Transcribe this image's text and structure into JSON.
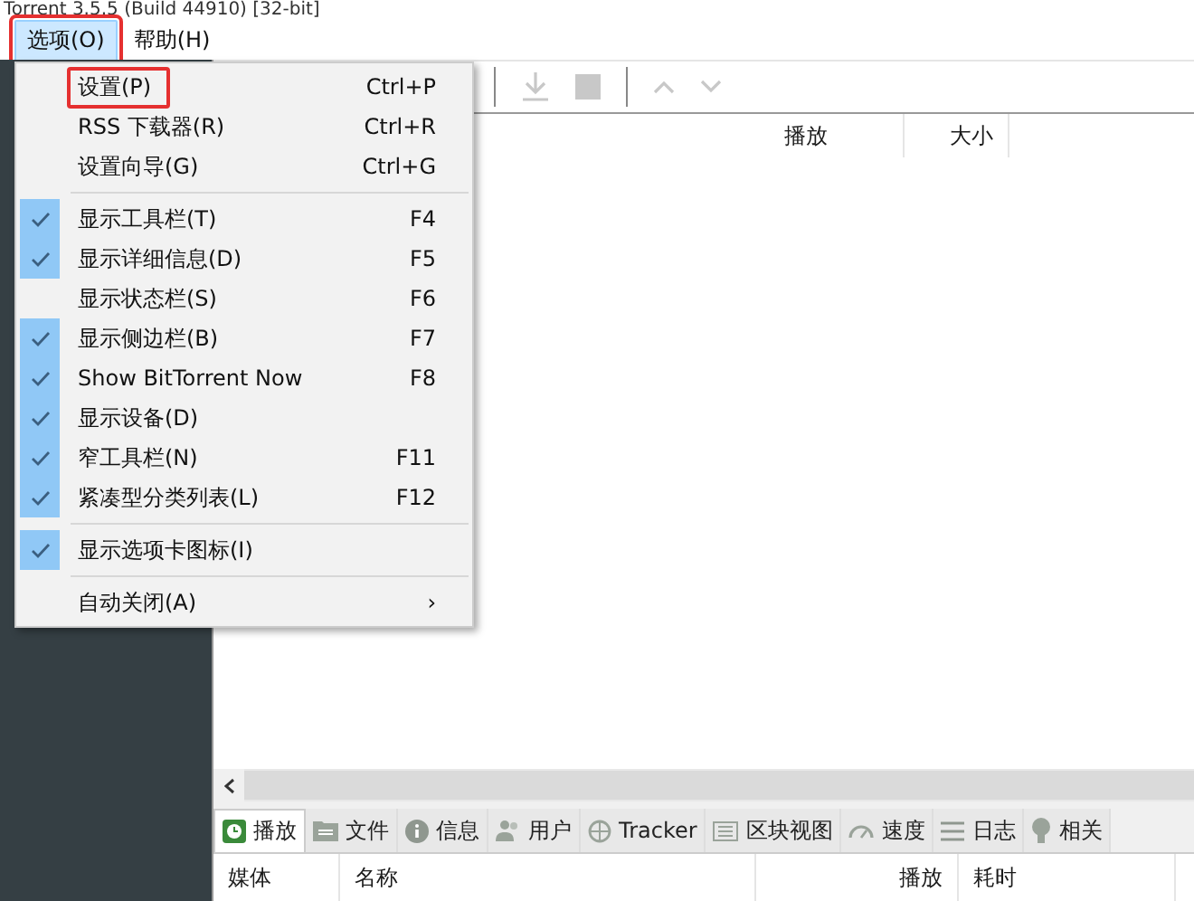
{
  "window": {
    "title": "Torrent 3.5.5  (Build 44910) [32-bit]"
  },
  "menubar": [
    {
      "label": "选项(O)",
      "selected": true,
      "highlighted": true
    },
    {
      "label": "帮助(H)",
      "selected": false,
      "highlighted": false
    }
  ],
  "menu": {
    "items": [
      {
        "kind": "item",
        "label": "设置(P)",
        "shortcut": "Ctrl+P",
        "checked": false,
        "highlighted": true
      },
      {
        "kind": "item",
        "label": "RSS 下载器(R)",
        "shortcut": "Ctrl+R",
        "checked": false,
        "highlighted": false
      },
      {
        "kind": "item",
        "label": "设置向导(G)",
        "shortcut": "Ctrl+G",
        "checked": false,
        "highlighted": false
      },
      {
        "kind": "separator"
      },
      {
        "kind": "item",
        "label": "显示工具栏(T)",
        "shortcut": "F4",
        "checked": true,
        "highlighted": false
      },
      {
        "kind": "item",
        "label": "显示详细信息(D)",
        "shortcut": "F5",
        "checked": true,
        "highlighted": false
      },
      {
        "kind": "item",
        "label": "显示状态栏(S)",
        "shortcut": "F6",
        "checked": false,
        "highlighted": false
      },
      {
        "kind": "item",
        "label": "显示侧边栏(B)",
        "shortcut": "F7",
        "checked": true,
        "highlighted": false
      },
      {
        "kind": "item",
        "label": "Show BitTorrent Now",
        "shortcut": "F8",
        "checked": true,
        "highlighted": false
      },
      {
        "kind": "item",
        "label": "显示设备(D)",
        "checked": true,
        "highlighted": false
      },
      {
        "kind": "item",
        "label": "窄工具栏(N)",
        "shortcut": "F11",
        "checked": true,
        "highlighted": false
      },
      {
        "kind": "item",
        "label": "紧凑型分类列表(L)",
        "shortcut": "F12",
        "checked": true,
        "highlighted": false
      },
      {
        "kind": "separator"
      },
      {
        "kind": "item",
        "label": "显示选项卡图标(I)",
        "checked": true,
        "highlighted": false
      },
      {
        "kind": "separator"
      },
      {
        "kind": "submenu",
        "label": "自动关闭(A)",
        "arrow": "›",
        "checked": false,
        "highlighted": false
      }
    ]
  },
  "torrent_list": {
    "columns": [
      "播放",
      "大小"
    ]
  },
  "detail_tabs": [
    {
      "label": "播放",
      "kind": "clock",
      "selected": true
    },
    {
      "label": "文件",
      "kind": "folder",
      "selected": false
    },
    {
      "label": "信息",
      "kind": "info",
      "selected": false
    },
    {
      "label": "用户",
      "kind": "users",
      "selected": false
    },
    {
      "label": "Tracker",
      "kind": "globe",
      "selected": false
    },
    {
      "label": "区块视图",
      "kind": "blocks",
      "selected": false
    },
    {
      "label": "速度",
      "kind": "speed",
      "selected": false
    },
    {
      "label": "日志",
      "kind": "list",
      "selected": false
    },
    {
      "label": "相关",
      "kind": "bulb",
      "selected": false
    }
  ],
  "detail_columns": [
    "媒体",
    "名称",
    "播放",
    "耗时"
  ]
}
